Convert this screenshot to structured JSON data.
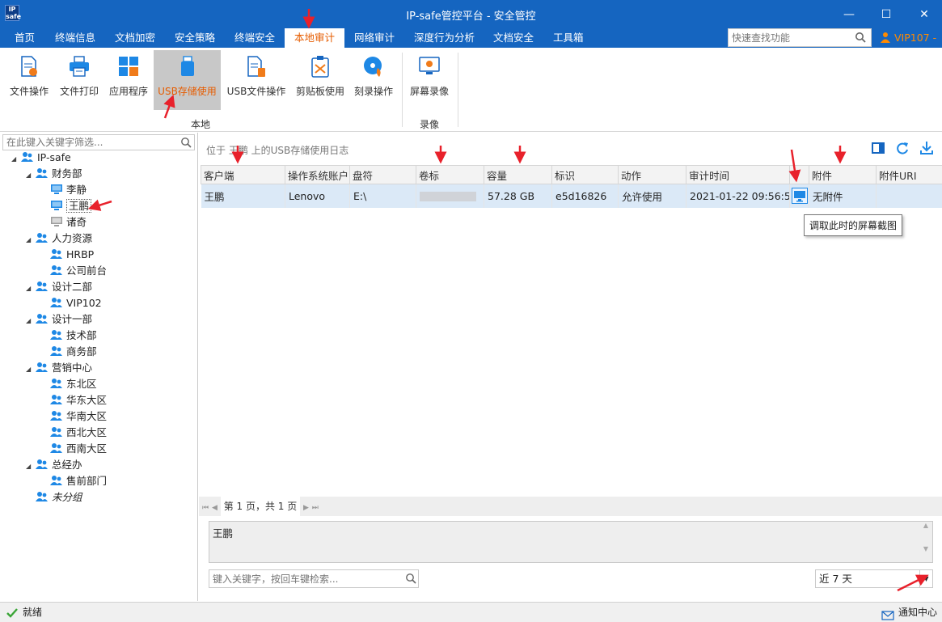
{
  "window": {
    "logo_text": "IP safe",
    "title": "IP-safe管控平台 - 安全管控",
    "minimize": "—",
    "maximize": "☐",
    "close": "✕"
  },
  "menu": {
    "items": [
      "首页",
      "终端信息",
      "文档加密",
      "安全策略",
      "终端安全",
      "本地审计",
      "网络审计",
      "深度行为分析",
      "文档安全",
      "工具箱"
    ],
    "active_index": 5,
    "search_placeholder": "快速查找功能",
    "user": "VIP107 -"
  },
  "ribbon": {
    "buttons": [
      {
        "label": "文件操作",
        "icon": "file-hand-icon"
      },
      {
        "label": "文件打印",
        "icon": "printer-icon"
      },
      {
        "label": "应用程序",
        "icon": "apps-grid-icon"
      },
      {
        "label": "USB存储使用",
        "icon": "usb-drive-icon",
        "selected": true
      },
      {
        "label": "USB文件操作",
        "icon": "usb-file-icon"
      },
      {
        "label": "剪贴板使用",
        "icon": "clipboard-icon"
      },
      {
        "label": "刻录操作",
        "icon": "disc-burn-icon"
      },
      {
        "label": "屏幕录像",
        "icon": "screen-record-icon"
      }
    ],
    "group_local": "本地",
    "group_record": "录像"
  },
  "tree": {
    "filter_placeholder": "在此键入关键字筛选...",
    "nodes": [
      {
        "label": "IP-safe",
        "type": "group",
        "level": 0,
        "toggle": "◢"
      },
      {
        "label": "财务部",
        "type": "group",
        "level": 1,
        "toggle": "◢"
      },
      {
        "label": "李静",
        "type": "pc",
        "level": 2
      },
      {
        "label": "王鹏",
        "type": "pc",
        "level": 2,
        "selected": true
      },
      {
        "label": "诸奇",
        "type": "pc-off",
        "level": 2
      },
      {
        "label": "人力资源",
        "type": "group",
        "level": 1,
        "toggle": "◢"
      },
      {
        "label": "HRBP",
        "type": "group",
        "level": 2
      },
      {
        "label": "公司前台",
        "type": "group",
        "level": 2
      },
      {
        "label": "设计二部",
        "type": "group",
        "level": 1,
        "toggle": "◢"
      },
      {
        "label": "VIP102",
        "type": "group",
        "level": 2
      },
      {
        "label": "设计一部",
        "type": "group",
        "level": 1,
        "toggle": "◢"
      },
      {
        "label": "技术部",
        "type": "group",
        "level": 2
      },
      {
        "label": "商务部",
        "type": "group",
        "level": 2
      },
      {
        "label": "营销中心",
        "type": "group",
        "level": 1,
        "toggle": "◢"
      },
      {
        "label": "东北区",
        "type": "group",
        "level": 2
      },
      {
        "label": "华东大区",
        "type": "group",
        "level": 2
      },
      {
        "label": "华南大区",
        "type": "group",
        "level": 2
      },
      {
        "label": "西北大区",
        "type": "group",
        "level": 2
      },
      {
        "label": "西南大区",
        "type": "group",
        "level": 2
      },
      {
        "label": "总经办",
        "type": "group",
        "level": 1,
        "toggle": "◢"
      },
      {
        "label": "售前部门",
        "type": "group",
        "level": 2
      },
      {
        "label": "未分组",
        "type": "group",
        "level": 1,
        "italic": true
      }
    ]
  },
  "log": {
    "breadcrumb": "位于 王鹏 上的USB存储使用日志",
    "columns": [
      "客户端",
      "操作系统账户",
      "盘符",
      "卷标",
      "容量",
      "标识",
      "动作",
      "审计时间",
      "",
      "附件",
      "附件URI"
    ],
    "rows": [
      {
        "client": "王鹏",
        "os_account": "Lenovo",
        "drive": "E:\\",
        "volume": "",
        "capacity": "57.28 GB",
        "id": "e5d16826",
        "action": "允许使用",
        "time": "2021-01-22 09:56:57",
        "attachment": "无附件",
        "uri": ""
      }
    ],
    "tooltip": "调取此时的屏幕截图",
    "pager_text": "第 1 页，共 1 页",
    "pager_first": "⏮",
    "pager_prev": "◀",
    "pager_next": "▶",
    "pager_last": "⏭",
    "detail_text": "王鹏",
    "search_placeholder": "键入关键字，按回车键检索...",
    "range_value": "近 7 天"
  },
  "status": {
    "ready": "就绪",
    "notify": "通知中心"
  },
  "colors": {
    "brand_blue": "#1565c0",
    "accent_orange": "#e65c00",
    "row_selected": "#dbe9f7",
    "annotation_red": "#e8212b"
  }
}
